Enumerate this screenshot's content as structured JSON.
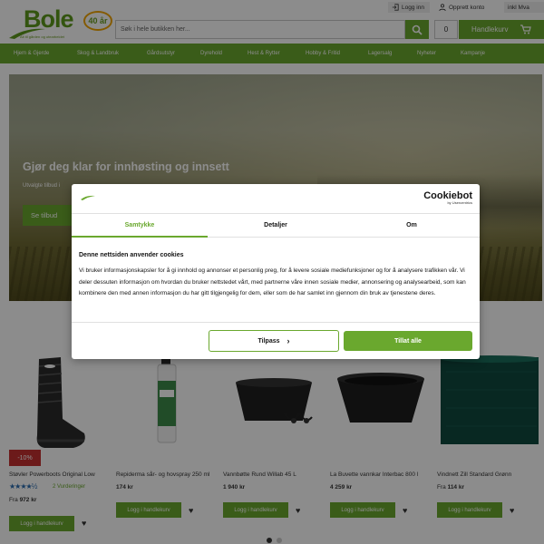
{
  "brand": {
    "name": "Bole",
    "badge": "40 år",
    "tagline": "Alt til gården og utearbeidet"
  },
  "header": {
    "login": "Logg inn",
    "create_account": "Opprett konto",
    "vat": "inkl Mva",
    "search_placeholder": "Søk i hele butikken her...",
    "cart_count": "0",
    "cart_label": "Handlekurv"
  },
  "nav": [
    "Hjem & Gjerde",
    "Skog & Landbruk",
    "Gårdsutstyr",
    "Dyrehold",
    "Hest & Rytter",
    "Hobby & Fritid",
    "Lagersalg",
    "Nyheter",
    "Kampanje"
  ],
  "hero": {
    "title": "Gjør deg klar for innhøsting og innsett",
    "subtitle": "Utvalgte tilbud i",
    "button": "Se tilbud"
  },
  "products": [
    {
      "name": "Støvler Powerboots Original Low",
      "discount": "-10%",
      "stars": "★★★★½",
      "reviews": "2 Vurderinger",
      "price_prefix": "Fra",
      "price": "972 kr",
      "button": "Logg i handlekurv"
    },
    {
      "name": "Repiderma sår- og hovspray 250 ml",
      "price": "174 kr",
      "button": "Logg i handlekurv"
    },
    {
      "name": "Vannbøtte Rund Willab 45 L",
      "price": "1 940 kr",
      "button": "Logg i handlekurv"
    },
    {
      "name": "La Buvette vannkar Interbac 800 l",
      "price": "4 259 kr",
      "button": "Logg i handlekurv"
    },
    {
      "name": "Vindnett Zill Standard Grønn",
      "price_prefix": "Fra",
      "price": "114 kr",
      "button": "Logg i handlekurv"
    }
  ],
  "cookie": {
    "brand": "Cookiebot",
    "brand_sub": "by Usercentrics",
    "tabs": [
      "Samtykke",
      "Detaljer",
      "Om"
    ],
    "heading": "Denne nettsiden anvender cookies",
    "body": "Vi bruker informasjonskapsler for å gi innhold og annonser et personlig preg, for å levere sosiale mediefunksjoner og for å analysere trafikken vår. Vi deler dessuten informasjon om hvordan du bruker nettstedet vårt, med partnerne våre innen sosiale medier, annonsering og analysearbeid, som kan kombinere den med annen informasjon du har gitt tilgjengelig for dem, eller som de har samlet inn gjennom din bruk av tjenestene deres.",
    "customize": "Tilpass",
    "allow_all": "Tillat alle"
  },
  "colors": {
    "accent": "#6aa82e",
    "discount": "#c53030"
  }
}
